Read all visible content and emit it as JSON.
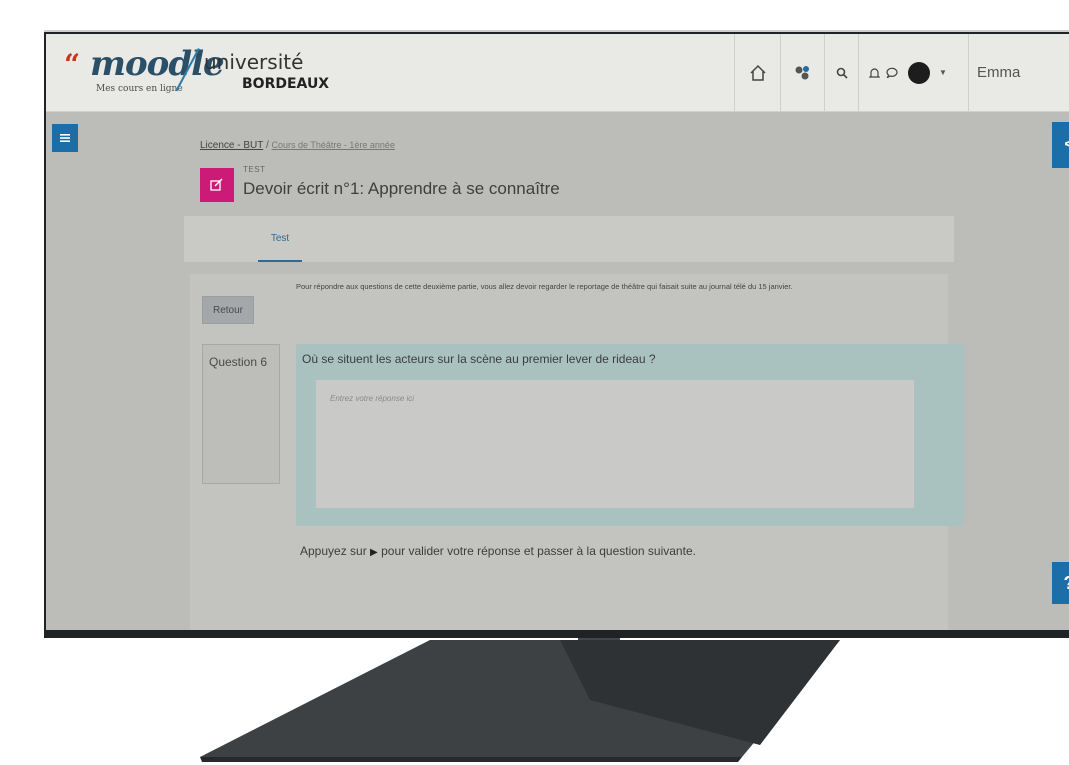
{
  "header": {
    "logo_mark": "⟨⟨",
    "logo_name": "moodle",
    "logo_tagline": "Mes cours en ligne",
    "university_name": "université",
    "university_city": "BORDEAUX",
    "user_name": "Emma"
  },
  "breadcrumb": {
    "items": [
      "Licence - BUT",
      "Cours de Théâtre -  1ère année"
    ],
    "separator": "/"
  },
  "activity": {
    "type": "TEST",
    "title": "Devoir écrit n°1: Apprendre à se connaître"
  },
  "tabs": [
    {
      "label": "Test"
    }
  ],
  "quiz": {
    "intro": "Pour répondre aux questions de cette deuxième partie, vous allez devoir regarder le reportage de théâtre qui faisait suite au journal télé du 15 janvier.",
    "back_label": "Retour",
    "question_number": "Question 6",
    "question_text": "Où se situent les acteurs sur la scène au premier lever de rideau ?",
    "answer_placeholder": "Entrez votre réponse ici",
    "hint_before": "Appuyez sur",
    "hint_after": "pour valider votre réponse et passer à la question suivante."
  },
  "side": {
    "right_tab_glyph": "<",
    "help_glyph": "?"
  },
  "colors": {
    "accent": "#1b6ea8",
    "activity_icon": "#cc1b77",
    "question_panel": "#a9c2c0",
    "moodle_blue": "#2a4f66"
  }
}
